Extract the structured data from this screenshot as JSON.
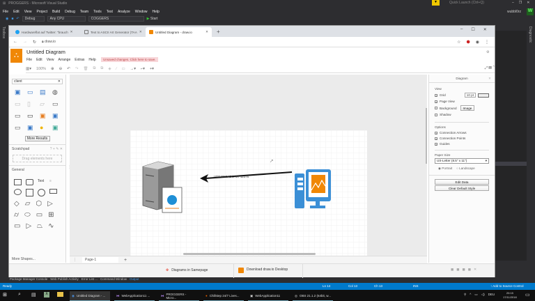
{
  "vs": {
    "title": "PROGGERS - Microsoft Visual Studio",
    "menu": [
      "File",
      "Edit",
      "View",
      "Project",
      "Build",
      "Debug",
      "Team",
      "Tools",
      "Test",
      "Analyze",
      "Window",
      "Help"
    ],
    "config": "Debug",
    "platform": "Any CPU",
    "project": "COGGERS",
    "start": "Start",
    "quick_launch": "Quick Launch (Ctrl+Q)",
    "user": "wubbl0rz",
    "user_initial": "W",
    "toolbox": "Toolbox",
    "right_strip": "Diagnostic",
    "bottom_tabs": [
      "Package Manager Console",
      "Web Publish Activity",
      "Error List ...",
      "Command Window",
      "Output"
    ],
    "status": {
      "ready": "Ready",
      "ln": "Ln 14",
      "col": "Col 13",
      "ch": "Ch 13",
      "ins": "INS",
      "source": "Add to Source Control"
    }
  },
  "browser": {
    "tabs": [
      "Hardwareflat auf Twitter: \"brauch",
      "Text to ASCII Art Generator (TAA",
      "Untitled Diagram - draw.io"
    ],
    "url": "draw.io"
  },
  "drawio": {
    "title": "Untitled Diagram",
    "menu": [
      "File",
      "Edit",
      "View",
      "Arrange",
      "Extras",
      "Help"
    ],
    "unsaved": "Unsaved changes. Click here to save.",
    "zoom": "100%",
    "search_value": "client",
    "more_results": "More Results",
    "scratchpad": "Scratchpad",
    "drag_here": "Drag elements here",
    "general": "General",
    "text_shape": "Text",
    "more_shapes": "More Shapes...",
    "edge_label": "UDP BROADCAST 12376",
    "page_tab": "Page-1",
    "panel": {
      "title": "Diagram",
      "view": "View",
      "grid": "Grid",
      "grid_size": "10 pt",
      "page_view": "Page View",
      "background": "Background",
      "image": "Image",
      "shadow": "Shadow",
      "options": "Options",
      "conn_arrows": "Connection Arrows",
      "conn_points": "Connection Points",
      "guides": "Guides",
      "paper_size": "Paper Size",
      "paper_value": "US-Letter (8.5\" x 11\")",
      "portrait": "Portrait",
      "landscape": "Landscape",
      "edit_data": "Edit Data",
      "clear_style": "Clear Default Style"
    },
    "footer": {
      "samepage": "Diagrams in Samepage",
      "download": "Download draw.io Desktop"
    },
    "accent": "#f08705"
  },
  "taskbar": {
    "items": [
      "Untitled Diagram - ...",
      "WebApplication11 ...",
      "PROGGERS - Micro...",
      "Chillstep 24/7 Lives...",
      "WebApplication11",
      "OBS 21.1.2 (64bit, w..."
    ],
    "lang": "DEU",
    "time": "20:15",
    "date": "17/11/2018"
  },
  "colors": {
    "vs_blue": "#007acc",
    "drawio_orange": "#f08705",
    "unsaved_bg": "#f8d7da"
  }
}
